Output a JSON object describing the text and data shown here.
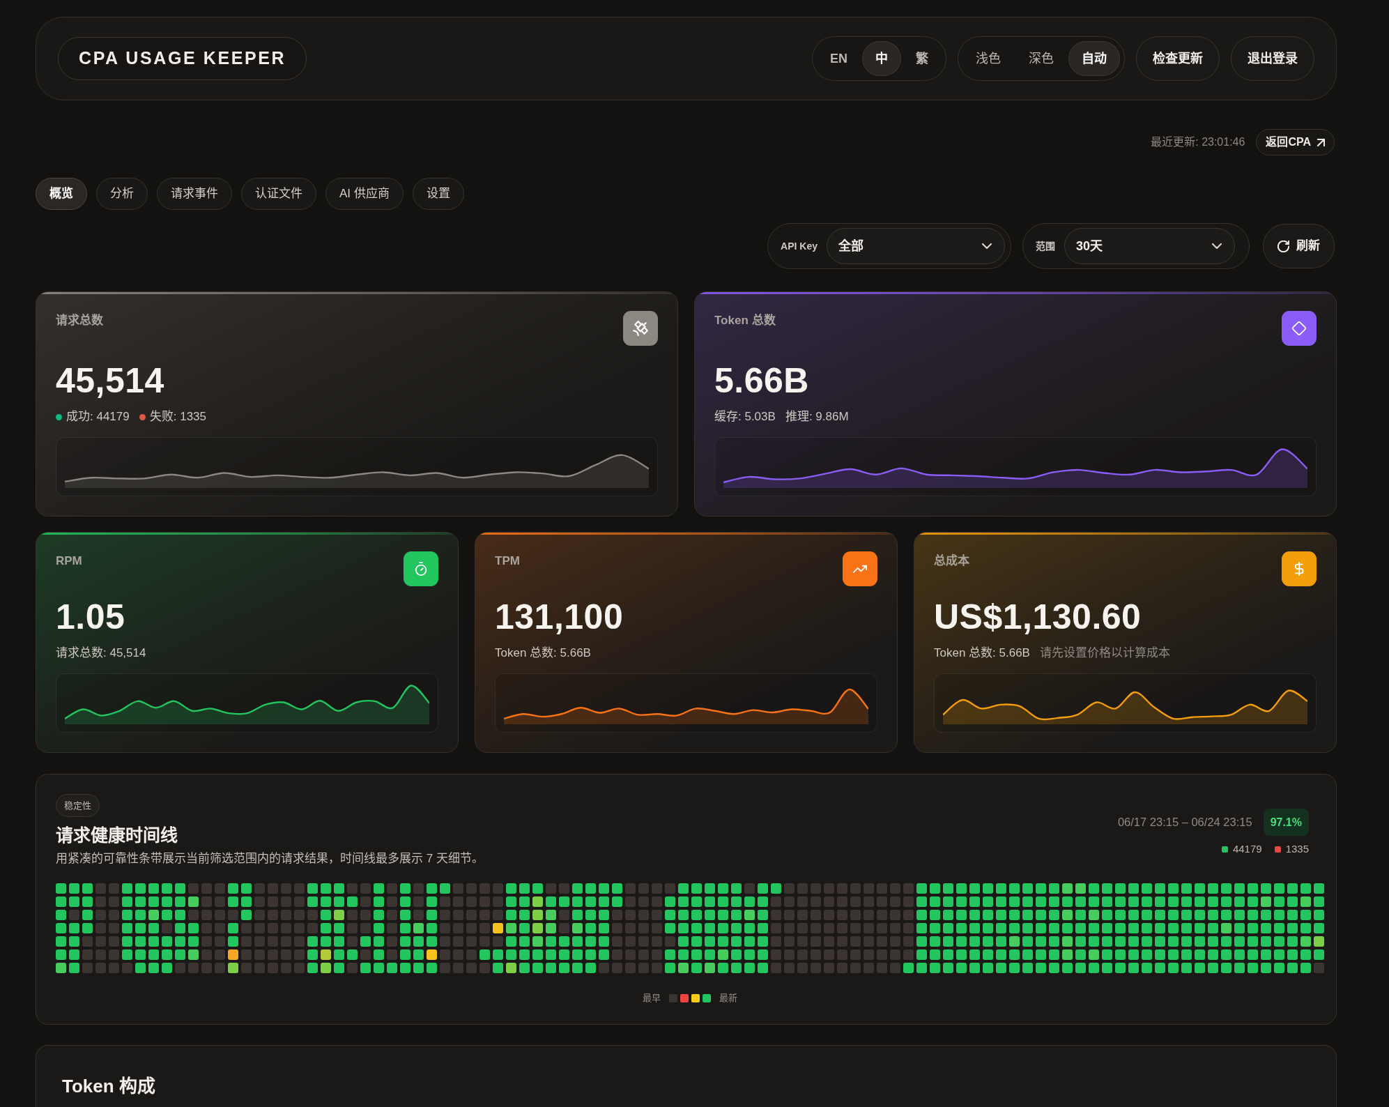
{
  "header": {
    "logo": "CPA USAGE KEEPER",
    "languages": [
      {
        "label": "EN",
        "selected": false
      },
      {
        "label": "中",
        "selected": true
      },
      {
        "label": "繁",
        "selected": false
      }
    ],
    "themes": [
      {
        "label": "浅色",
        "selected": false
      },
      {
        "label": "深色",
        "selected": false
      },
      {
        "label": "自动",
        "selected": true
      }
    ],
    "buttons": [
      "检查更新",
      "退出登录"
    ]
  },
  "meta": {
    "last_updated": "最近更新: 23:01:46",
    "back_link": "返回CPA"
  },
  "tabs": [
    {
      "label": "概览",
      "selected": true
    },
    {
      "label": "分析",
      "selected": false
    },
    {
      "label": "请求事件",
      "selected": false
    },
    {
      "label": "认证文件",
      "selected": false
    },
    {
      "label": "AI 供应商",
      "selected": false
    },
    {
      "label": "设置",
      "selected": false
    }
  ],
  "filters": [
    {
      "label": "API Key",
      "value": "全部"
    },
    {
      "label": "范围",
      "value": "30天"
    }
  ],
  "refresh_button": "刷新",
  "stat_rows": [
    [
      {
        "label": "请求总数",
        "value": "45,514",
        "color": "#8c8781",
        "details": [
          {
            "text": "成功: 44179",
            "color": "#10b981",
            "muted": false
          },
          {
            "text": "失败: 1335",
            "color": "#dc5a43",
            "muted": false
          }
        ]
      },
      {
        "label": "Token 总数",
        "value": "5.66B",
        "color": "#8b5cf6",
        "details": [
          {
            "text": "缓存: 5.03B",
            "muted": false
          },
          {
            "text": "推理: 9.86M",
            "muted": false
          }
        ]
      }
    ],
    [
      {
        "label": "RPM",
        "value": "1.05",
        "color": "#22c55e",
        "details": [
          {
            "text": "请求总数: 45,514",
            "muted": false
          }
        ]
      },
      {
        "label": "TPM",
        "value": "131,100",
        "color": "#f97316",
        "details": [
          {
            "text": "Token 总数: 5.66B",
            "muted": false
          }
        ]
      },
      {
        "label": "总成本",
        "value": "US$1,130.60",
        "color": "#f59e0b",
        "details": [
          {
            "text": "Token 总数: 5.66B",
            "muted": false
          },
          {
            "text": "请先设置价格以计算成本",
            "muted": true
          }
        ]
      }
    ]
  ],
  "health": {
    "tag": "稳定性",
    "title": "请求健康时间线",
    "description": "用紧凑的可靠性条带展示当前筛选范围内的请求结果，时间线最多展示 7 天细节。",
    "range": "06/17 23:15 – 06/24 23:15",
    "rate": "97.1%",
    "counts": [
      {
        "text": "44179",
        "color": "#22c55e"
      },
      {
        "text": "1335",
        "color": "#ef4444"
      }
    ],
    "grid": [
      [
        {
          "kind": "ok"
        },
        {
          "kind": "ok"
        },
        {
          "kind": "ok"
        },
        {
          "kind": "none"
        },
        {
          "kind": "none"
        },
        {
          "kind": "ok"
        },
        {
          "kind": "ok"
        },
        {
          "kind": "ok"
        },
        {
          "kind": "ok"
        },
        {
          "kind": "ok"
        },
        {
          "kind": "none"
        },
        {
          "kind": "none"
        },
        {
          "kind": "none"
        },
        {
          "kind": "ok"
        },
        {
          "kind": "ok"
        },
        {
          "kind": "none"
        },
        {
          "kind": "none"
        },
        {
          "kind": "none"
        },
        {
          "kind": "none"
        },
        {
          "kind": "ok"
        },
        {
          "kind": "ok"
        },
        {
          "kind": "ok"
        },
        {
          "kind": "none"
        },
        {
          "kind": "none"
        },
        {
          "kind": "ok"
        },
        {
          "kind": "none"
        },
        {
          "kind": "ok"
        },
        {
          "kind": "none"
        },
        {
          "kind": "ok"
        },
        {
          "kind": "ok"
        },
        {
          "kind": "none"
        },
        {
          "kind": "none"
        },
        {
          "kind": "none"
        },
        {
          "kind": "none"
        },
        {
          "kind": "ok"
        },
        {
          "kind": "ok"
        },
        {
          "kind": "ok"
        },
        {
          "kind": "none"
        },
        {
          "kind": "none"
        },
        {
          "kind": "ok"
        },
        {
          "kind": "ok"
        },
        {
          "kind": "ok"
        },
        {
          "kind": "ok"
        },
        {
          "kind": "none"
        },
        {
          "kind": "none"
        },
        {
          "kind": "none"
        },
        {
          "kind": "none"
        },
        {
          "kind": "ok"
        },
        {
          "kind": "ok"
        },
        {
          "kind": "ok"
        },
        {
          "kind": "ok"
        },
        {
          "kind": "ok"
        },
        {
          "kind": "none"
        },
        {
          "kind": "ok"
        },
        {
          "kind": "ok"
        },
        {
          "kind": "none"
        },
        {
          "kind": "none"
        },
        {
          "kind": "none"
        },
        {
          "kind": "none"
        },
        {
          "kind": "none"
        },
        {
          "kind": "none"
        },
        {
          "kind": "none"
        },
        {
          "kind": "none"
        },
        {
          "kind": "none"
        },
        {
          "kind": "none"
        },
        {
          "kind": "ok"
        },
        {
          "kind": "ok"
        },
        {
          "kind": "ok"
        },
        {
          "kind": "ok"
        },
        {
          "kind": "ok"
        },
        {
          "kind": "ok"
        },
        {
          "kind": "ok"
        },
        {
          "kind": "ok"
        },
        {
          "kind": "ok"
        },
        {
          "kind": "ok"
        },
        {
          "kind": "ok"
        },
        {
          "kind": "hi"
        },
        {
          "kind": "hi"
        },
        {
          "kind": "ok"
        },
        {
          "kind": "ok"
        },
        {
          "kind": "ok"
        },
        {
          "kind": "ok"
        },
        {
          "kind": "ok"
        },
        {
          "kind": "ok"
        },
        {
          "kind": "ok"
        },
        {
          "kind": "ok"
        },
        {
          "kind": "ok"
        },
        {
          "kind": "ok"
        },
        {
          "kind": "ok"
        },
        {
          "kind": "ok"
        },
        {
          "kind": "ok"
        },
        {
          "kind": "ok"
        },
        {
          "kind": "ok"
        },
        {
          "kind": "ok"
        },
        {
          "kind": "ok"
        },
        {
          "kind": "ok"
        }
      ],
      [
        {
          "kind": "ok"
        },
        {
          "kind": "ok"
        },
        {
          "kind": "ok"
        },
        {
          "kind": "none"
        },
        {
          "kind": "none"
        },
        {
          "kind": "ok"
        },
        {
          "kind": "ok"
        },
        {
          "kind": "ok"
        },
        {
          "kind": "ok"
        },
        {
          "kind": "ok"
        },
        {
          "kind": "hi"
        },
        {
          "kind": "none"
        },
        {
          "kind": "none"
        },
        {
          "kind": "ok"
        },
        {
          "kind": "ok"
        },
        {
          "kind": "none"
        },
        {
          "kind": "none"
        },
        {
          "kind": "none"
        },
        {
          "kind": "none"
        },
        {
          "kind": "ok"
        },
        {
          "kind": "ok"
        },
        {
          "kind": "ok"
        },
        {
          "kind": "ok"
        },
        {
          "kind": "none"
        },
        {
          "kind": "ok"
        },
        {
          "kind": "none"
        },
        {
          "kind": "ok"
        },
        {
          "kind": "none"
        },
        {
          "kind": "ok"
        },
        {
          "kind": "none"
        },
        {
          "kind": "none"
        },
        {
          "kind": "none"
        },
        {
          "kind": "none"
        },
        {
          "kind": "none"
        },
        {
          "kind": "ok"
        },
        {
          "kind": "ok"
        },
        {
          "kind": "mid"
        },
        {
          "kind": "ok"
        },
        {
          "kind": "ok"
        },
        {
          "kind": "ok"
        },
        {
          "kind": "ok"
        },
        {
          "kind": "ok"
        },
        {
          "kind": "ok"
        },
        {
          "kind": "none"
        },
        {
          "kind": "none"
        },
        {
          "kind": "none"
        },
        {
          "kind": "ok"
        },
        {
          "kind": "ok"
        },
        {
          "kind": "ok"
        },
        {
          "kind": "ok"
        },
        {
          "kind": "ok"
        },
        {
          "kind": "ok"
        },
        {
          "kind": "ok"
        },
        {
          "kind": "ok"
        },
        {
          "kind": "none"
        },
        {
          "kind": "none"
        },
        {
          "kind": "none"
        },
        {
          "kind": "none"
        },
        {
          "kind": "none"
        },
        {
          "kind": "none"
        },
        {
          "kind": "none"
        },
        {
          "kind": "none"
        },
        {
          "kind": "none"
        },
        {
          "kind": "none"
        },
        {
          "kind": "none"
        },
        {
          "kind": "ok"
        },
        {
          "kind": "ok"
        },
        {
          "kind": "ok"
        },
        {
          "kind": "ok"
        },
        {
          "kind": "ok"
        },
        {
          "kind": "ok"
        },
        {
          "kind": "ok"
        },
        {
          "kind": "ok"
        },
        {
          "kind": "ok"
        },
        {
          "kind": "ok"
        },
        {
          "kind": "ok"
        },
        {
          "kind": "ok"
        },
        {
          "kind": "ok"
        },
        {
          "kind": "ok"
        },
        {
          "kind": "ok"
        },
        {
          "kind": "ok"
        },
        {
          "kind": "ok"
        },
        {
          "kind": "ok"
        },
        {
          "kind": "ok"
        },
        {
          "kind": "ok"
        },
        {
          "kind": "ok"
        },
        {
          "kind": "ok"
        },
        {
          "kind": "ok"
        },
        {
          "kind": "ok"
        },
        {
          "kind": "ok"
        },
        {
          "kind": "ok"
        },
        {
          "kind": "hi"
        },
        {
          "kind": "ok"
        },
        {
          "kind": "ok"
        },
        {
          "kind": "hi"
        },
        {
          "kind": "ok"
        }
      ],
      [
        {
          "kind": "ok"
        },
        {
          "kind": "none"
        },
        {
          "kind": "ok"
        },
        {
          "kind": "none"
        },
        {
          "kind": "none"
        },
        {
          "kind": "ok"
        },
        {
          "kind": "ok"
        },
        {
          "kind": "hi"
        },
        {
          "kind": "ok"
        },
        {
          "kind": "ok"
        },
        {
          "kind": "none"
        },
        {
          "kind": "none"
        },
        {
          "kind": "none"
        },
        {
          "kind": "none"
        },
        {
          "kind": "ok"
        },
        {
          "kind": "none"
        },
        {
          "kind": "none"
        },
        {
          "kind": "none"
        },
        {
          "kind": "none"
        },
        {
          "kind": "none"
        },
        {
          "kind": "ok"
        },
        {
          "kind": "mid"
        },
        {
          "kind": "none"
        },
        {
          "kind": "none"
        },
        {
          "kind": "ok"
        },
        {
          "kind": "none"
        },
        {
          "kind": "ok"
        },
        {
          "kind": "none"
        },
        {
          "kind": "ok"
        },
        {
          "kind": "none"
        },
        {
          "kind": "none"
        },
        {
          "kind": "none"
        },
        {
          "kind": "none"
        },
        {
          "kind": "none"
        },
        {
          "kind": "ok"
        },
        {
          "kind": "ok"
        },
        {
          "kind": "mid"
        },
        {
          "kind": "hi"
        },
        {
          "kind": "none"
        },
        {
          "kind": "ok"
        },
        {
          "kind": "ok"
        },
        {
          "kind": "ok"
        },
        {
          "kind": "none"
        },
        {
          "kind": "none"
        },
        {
          "kind": "none"
        },
        {
          "kind": "none"
        },
        {
          "kind": "ok"
        },
        {
          "kind": "ok"
        },
        {
          "kind": "ok"
        },
        {
          "kind": "ok"
        },
        {
          "kind": "ok"
        },
        {
          "kind": "ok"
        },
        {
          "kind": "hi"
        },
        {
          "kind": "ok"
        },
        {
          "kind": "none"
        },
        {
          "kind": "none"
        },
        {
          "kind": "none"
        },
        {
          "kind": "none"
        },
        {
          "kind": "none"
        },
        {
          "kind": "none"
        },
        {
          "kind": "none"
        },
        {
          "kind": "none"
        },
        {
          "kind": "none"
        },
        {
          "kind": "none"
        },
        {
          "kind": "none"
        },
        {
          "kind": "ok"
        },
        {
          "kind": "ok"
        },
        {
          "kind": "ok"
        },
        {
          "kind": "ok"
        },
        {
          "kind": "ok"
        },
        {
          "kind": "ok"
        },
        {
          "kind": "ok"
        },
        {
          "kind": "ok"
        },
        {
          "kind": "ok"
        },
        {
          "kind": "ok"
        },
        {
          "kind": "ok"
        },
        {
          "kind": "hi"
        },
        {
          "kind": "ok"
        },
        {
          "kind": "hi"
        },
        {
          "kind": "ok"
        },
        {
          "kind": "ok"
        },
        {
          "kind": "ok"
        },
        {
          "kind": "ok"
        },
        {
          "kind": "ok"
        },
        {
          "kind": "ok"
        },
        {
          "kind": "ok"
        },
        {
          "kind": "ok"
        },
        {
          "kind": "ok"
        },
        {
          "kind": "ok"
        },
        {
          "kind": "ok"
        },
        {
          "kind": "ok"
        },
        {
          "kind": "ok"
        },
        {
          "kind": "ok"
        },
        {
          "kind": "ok"
        },
        {
          "kind": "ok"
        },
        {
          "kind": "ok"
        }
      ],
      [
        {
          "kind": "ok"
        },
        {
          "kind": "ok"
        },
        {
          "kind": "ok"
        },
        {
          "kind": "none"
        },
        {
          "kind": "none"
        },
        {
          "kind": "ok"
        },
        {
          "kind": "ok"
        },
        {
          "kind": "ok"
        },
        {
          "kind": "none"
        },
        {
          "kind": "ok"
        },
        {
          "kind": "ok"
        },
        {
          "kind": "none"
        },
        {
          "kind": "none"
        },
        {
          "kind": "ok"
        },
        {
          "kind": "none"
        },
        {
          "kind": "none"
        },
        {
          "kind": "none"
        },
        {
          "kind": "none"
        },
        {
          "kind": "none"
        },
        {
          "kind": "none"
        },
        {
          "kind": "ok"
        },
        {
          "kind": "ok"
        },
        {
          "kind": "none"
        },
        {
          "kind": "none"
        },
        {
          "kind": "ok"
        },
        {
          "kind": "none"
        },
        {
          "kind": "ok"
        },
        {
          "kind": "hi"
        },
        {
          "kind": "ok"
        },
        {
          "kind": "none"
        },
        {
          "kind": "none"
        },
        {
          "kind": "none"
        },
        {
          "kind": "none"
        },
        {
          "kind": "low"
        },
        {
          "kind": "hi"
        },
        {
          "kind": "ok"
        },
        {
          "kind": "mid"
        },
        {
          "kind": "hi"
        },
        {
          "kind": "none"
        },
        {
          "kind": "hi"
        },
        {
          "kind": "ok"
        },
        {
          "kind": "ok"
        },
        {
          "kind": "none"
        },
        {
          "kind": "none"
        },
        {
          "kind": "none"
        },
        {
          "kind": "none"
        },
        {
          "kind": "ok"
        },
        {
          "kind": "ok"
        },
        {
          "kind": "ok"
        },
        {
          "kind": "ok"
        },
        {
          "kind": "ok"
        },
        {
          "kind": "ok"
        },
        {
          "kind": "ok"
        },
        {
          "kind": "ok"
        },
        {
          "kind": "none"
        },
        {
          "kind": "none"
        },
        {
          "kind": "none"
        },
        {
          "kind": "none"
        },
        {
          "kind": "none"
        },
        {
          "kind": "none"
        },
        {
          "kind": "none"
        },
        {
          "kind": "none"
        },
        {
          "kind": "none"
        },
        {
          "kind": "none"
        },
        {
          "kind": "none"
        },
        {
          "kind": "ok"
        },
        {
          "kind": "ok"
        },
        {
          "kind": "ok"
        },
        {
          "kind": "ok"
        },
        {
          "kind": "ok"
        },
        {
          "kind": "ok"
        },
        {
          "kind": "ok"
        },
        {
          "kind": "ok"
        },
        {
          "kind": "ok"
        },
        {
          "kind": "ok"
        },
        {
          "kind": "ok"
        },
        {
          "kind": "ok"
        },
        {
          "kind": "ok"
        },
        {
          "kind": "ok"
        },
        {
          "kind": "ok"
        },
        {
          "kind": "ok"
        },
        {
          "kind": "ok"
        },
        {
          "kind": "ok"
        },
        {
          "kind": "ok"
        },
        {
          "kind": "ok"
        },
        {
          "kind": "ok"
        },
        {
          "kind": "ok"
        },
        {
          "kind": "ok"
        },
        {
          "kind": "hi"
        },
        {
          "kind": "ok"
        },
        {
          "kind": "ok"
        },
        {
          "kind": "ok"
        },
        {
          "kind": "ok"
        },
        {
          "kind": "ok"
        },
        {
          "kind": "ok"
        },
        {
          "kind": "ok"
        }
      ],
      [
        {
          "kind": "ok"
        },
        {
          "kind": "ok"
        },
        {
          "kind": "none"
        },
        {
          "kind": "none"
        },
        {
          "kind": "none"
        },
        {
          "kind": "ok"
        },
        {
          "kind": "ok"
        },
        {
          "kind": "ok"
        },
        {
          "kind": "ok"
        },
        {
          "kind": "ok"
        },
        {
          "kind": "ok"
        },
        {
          "kind": "none"
        },
        {
          "kind": "none"
        },
        {
          "kind": "ok"
        },
        {
          "kind": "none"
        },
        {
          "kind": "none"
        },
        {
          "kind": "none"
        },
        {
          "kind": "none"
        },
        {
          "kind": "none"
        },
        {
          "kind": "ok"
        },
        {
          "kind": "ok"
        },
        {
          "kind": "ok"
        },
        {
          "kind": "none"
        },
        {
          "kind": "ok"
        },
        {
          "kind": "ok"
        },
        {
          "kind": "none"
        },
        {
          "kind": "ok"
        },
        {
          "kind": "ok"
        },
        {
          "kind": "ok"
        },
        {
          "kind": "none"
        },
        {
          "kind": "none"
        },
        {
          "kind": "none"
        },
        {
          "kind": "none"
        },
        {
          "kind": "none"
        },
        {
          "kind": "ok"
        },
        {
          "kind": "ok"
        },
        {
          "kind": "hi"
        },
        {
          "kind": "ok"
        },
        {
          "kind": "ok"
        },
        {
          "kind": "ok"
        },
        {
          "kind": "ok"
        },
        {
          "kind": "ok"
        },
        {
          "kind": "none"
        },
        {
          "kind": "none"
        },
        {
          "kind": "none"
        },
        {
          "kind": "none"
        },
        {
          "kind": "none"
        },
        {
          "kind": "ok"
        },
        {
          "kind": "ok"
        },
        {
          "kind": "ok"
        },
        {
          "kind": "ok"
        },
        {
          "kind": "ok"
        },
        {
          "kind": "ok"
        },
        {
          "kind": "ok"
        },
        {
          "kind": "none"
        },
        {
          "kind": "none"
        },
        {
          "kind": "none"
        },
        {
          "kind": "none"
        },
        {
          "kind": "none"
        },
        {
          "kind": "none"
        },
        {
          "kind": "none"
        },
        {
          "kind": "none"
        },
        {
          "kind": "none"
        },
        {
          "kind": "none"
        },
        {
          "kind": "none"
        },
        {
          "kind": "ok"
        },
        {
          "kind": "ok"
        },
        {
          "kind": "ok"
        },
        {
          "kind": "ok"
        },
        {
          "kind": "ok"
        },
        {
          "kind": "ok"
        },
        {
          "kind": "ok"
        },
        {
          "kind": "hi"
        },
        {
          "kind": "ok"
        },
        {
          "kind": "ok"
        },
        {
          "kind": "ok"
        },
        {
          "kind": "hi"
        },
        {
          "kind": "ok"
        },
        {
          "kind": "ok"
        },
        {
          "kind": "ok"
        },
        {
          "kind": "ok"
        },
        {
          "kind": "ok"
        },
        {
          "kind": "ok"
        },
        {
          "kind": "ok"
        },
        {
          "kind": "ok"
        },
        {
          "kind": "ok"
        },
        {
          "kind": "ok"
        },
        {
          "kind": "ok"
        },
        {
          "kind": "ok"
        },
        {
          "kind": "ok"
        },
        {
          "kind": "ok"
        },
        {
          "kind": "ok"
        },
        {
          "kind": "ok"
        },
        {
          "kind": "ok"
        },
        {
          "kind": "hi"
        },
        {
          "kind": "mid"
        }
      ],
      [
        {
          "kind": "ok"
        },
        {
          "kind": "ok"
        },
        {
          "kind": "none"
        },
        {
          "kind": "none"
        },
        {
          "kind": "none"
        },
        {
          "kind": "ok"
        },
        {
          "kind": "ok"
        },
        {
          "kind": "ok"
        },
        {
          "kind": "ok"
        },
        {
          "kind": "ok"
        },
        {
          "kind": "hi"
        },
        {
          "kind": "none"
        },
        {
          "kind": "none"
        },
        {
          "kind": "bad"
        },
        {
          "kind": "none"
        },
        {
          "kind": "none"
        },
        {
          "kind": "none"
        },
        {
          "kind": "none"
        },
        {
          "kind": "none"
        },
        {
          "kind": "ok"
        },
        {
          "kind": "warn"
        },
        {
          "kind": "ok"
        },
        {
          "kind": "ok"
        },
        {
          "kind": "none"
        },
        {
          "kind": "ok"
        },
        {
          "kind": "none"
        },
        {
          "kind": "ok"
        },
        {
          "kind": "ok"
        },
        {
          "kind": "low"
        },
        {
          "kind": "none"
        },
        {
          "kind": "none"
        },
        {
          "kind": "none"
        },
        {
          "kind": "ok"
        },
        {
          "kind": "ok"
        },
        {
          "kind": "ok"
        },
        {
          "kind": "ok"
        },
        {
          "kind": "ok"
        },
        {
          "kind": "ok"
        },
        {
          "kind": "ok"
        },
        {
          "kind": "ok"
        },
        {
          "kind": "ok"
        },
        {
          "kind": "ok"
        },
        {
          "kind": "none"
        },
        {
          "kind": "none"
        },
        {
          "kind": "none"
        },
        {
          "kind": "none"
        },
        {
          "kind": "ok"
        },
        {
          "kind": "ok"
        },
        {
          "kind": "ok"
        },
        {
          "kind": "ok"
        },
        {
          "kind": "hi"
        },
        {
          "kind": "ok"
        },
        {
          "kind": "ok"
        },
        {
          "kind": "ok"
        },
        {
          "kind": "none"
        },
        {
          "kind": "none"
        },
        {
          "kind": "none"
        },
        {
          "kind": "none"
        },
        {
          "kind": "none"
        },
        {
          "kind": "none"
        },
        {
          "kind": "none"
        },
        {
          "kind": "none"
        },
        {
          "kind": "none"
        },
        {
          "kind": "none"
        },
        {
          "kind": "none"
        },
        {
          "kind": "ok"
        },
        {
          "kind": "ok"
        },
        {
          "kind": "ok"
        },
        {
          "kind": "ok"
        },
        {
          "kind": "ok"
        },
        {
          "kind": "ok"
        },
        {
          "kind": "ok"
        },
        {
          "kind": "ok"
        },
        {
          "kind": "ok"
        },
        {
          "kind": "ok"
        },
        {
          "kind": "ok"
        },
        {
          "kind": "hi"
        },
        {
          "kind": "ok"
        },
        {
          "kind": "hi"
        },
        {
          "kind": "ok"
        },
        {
          "kind": "ok"
        },
        {
          "kind": "ok"
        },
        {
          "kind": "ok"
        },
        {
          "kind": "ok"
        },
        {
          "kind": "ok"
        },
        {
          "kind": "ok"
        },
        {
          "kind": "ok"
        },
        {
          "kind": "ok"
        },
        {
          "kind": "ok"
        },
        {
          "kind": "ok"
        },
        {
          "kind": "ok"
        },
        {
          "kind": "ok"
        },
        {
          "kind": "ok"
        },
        {
          "kind": "ok"
        },
        {
          "kind": "ok"
        },
        {
          "kind": "ok"
        }
      ],
      [
        {
          "kind": "hi"
        },
        {
          "kind": "ok"
        },
        {
          "kind": "none"
        },
        {
          "kind": "none"
        },
        {
          "kind": "none"
        },
        {
          "kind": "none"
        },
        {
          "kind": "ok"
        },
        {
          "kind": "ok"
        },
        {
          "kind": "ok"
        },
        {
          "kind": "none"
        },
        {
          "kind": "none"
        },
        {
          "kind": "none"
        },
        {
          "kind": "none"
        },
        {
          "kind": "mid"
        },
        {
          "kind": "none"
        },
        {
          "kind": "none"
        },
        {
          "kind": "none"
        },
        {
          "kind": "none"
        },
        {
          "kind": "none"
        },
        {
          "kind": "ok"
        },
        {
          "kind": "mid"
        },
        {
          "kind": "ok"
        },
        {
          "kind": "none"
        },
        {
          "kind": "ok"
        },
        {
          "kind": "ok"
        },
        {
          "kind": "ok"
        },
        {
          "kind": "ok"
        },
        {
          "kind": "ok"
        },
        {
          "kind": "ok"
        },
        {
          "kind": "none"
        },
        {
          "kind": "none"
        },
        {
          "kind": "none"
        },
        {
          "kind": "none"
        },
        {
          "kind": "ok"
        },
        {
          "kind": "mid"
        },
        {
          "kind": "ok"
        },
        {
          "kind": "ok"
        },
        {
          "kind": "ok"
        },
        {
          "kind": "ok"
        },
        {
          "kind": "ok"
        },
        {
          "kind": "ok"
        },
        {
          "kind": "none"
        },
        {
          "kind": "none"
        },
        {
          "kind": "none"
        },
        {
          "kind": "none"
        },
        {
          "kind": "none"
        },
        {
          "kind": "ok"
        },
        {
          "kind": "hi"
        },
        {
          "kind": "ok"
        },
        {
          "kind": "hi"
        },
        {
          "kind": "ok"
        },
        {
          "kind": "ok"
        },
        {
          "kind": "ok"
        },
        {
          "kind": "ok"
        },
        {
          "kind": "none"
        },
        {
          "kind": "none"
        },
        {
          "kind": "none"
        },
        {
          "kind": "none"
        },
        {
          "kind": "none"
        },
        {
          "kind": "none"
        },
        {
          "kind": "none"
        },
        {
          "kind": "none"
        },
        {
          "kind": "none"
        },
        {
          "kind": "none"
        },
        {
          "kind": "ok"
        },
        {
          "kind": "ok"
        },
        {
          "kind": "ok"
        },
        {
          "kind": "ok"
        },
        {
          "kind": "ok"
        },
        {
          "kind": "ok"
        },
        {
          "kind": "ok"
        },
        {
          "kind": "ok"
        },
        {
          "kind": "ok"
        },
        {
          "kind": "ok"
        },
        {
          "kind": "ok"
        },
        {
          "kind": "ok"
        },
        {
          "kind": "ok"
        },
        {
          "kind": "ok"
        },
        {
          "kind": "ok"
        },
        {
          "kind": "ok"
        },
        {
          "kind": "ok"
        },
        {
          "kind": "ok"
        },
        {
          "kind": "ok"
        },
        {
          "kind": "ok"
        },
        {
          "kind": "ok"
        },
        {
          "kind": "ok"
        },
        {
          "kind": "ok"
        },
        {
          "kind": "ok"
        },
        {
          "kind": "ok"
        },
        {
          "kind": "ok"
        },
        {
          "kind": "ok"
        },
        {
          "kind": "ok"
        },
        {
          "kind": "ok"
        },
        {
          "kind": "ok"
        },
        {
          "kind": "ok"
        },
        {
          "kind": "none"
        }
      ]
    ],
    "legend": {
      "start": "最早",
      "swatches": [
        {
          "color": "#3b3431"
        },
        {
          "color": "#ef4444"
        },
        {
          "color": "#facc15"
        },
        {
          "color": "#22c55e"
        }
      ],
      "end": "最新"
    }
  },
  "token_section": {
    "title": "Token 构成"
  }
}
